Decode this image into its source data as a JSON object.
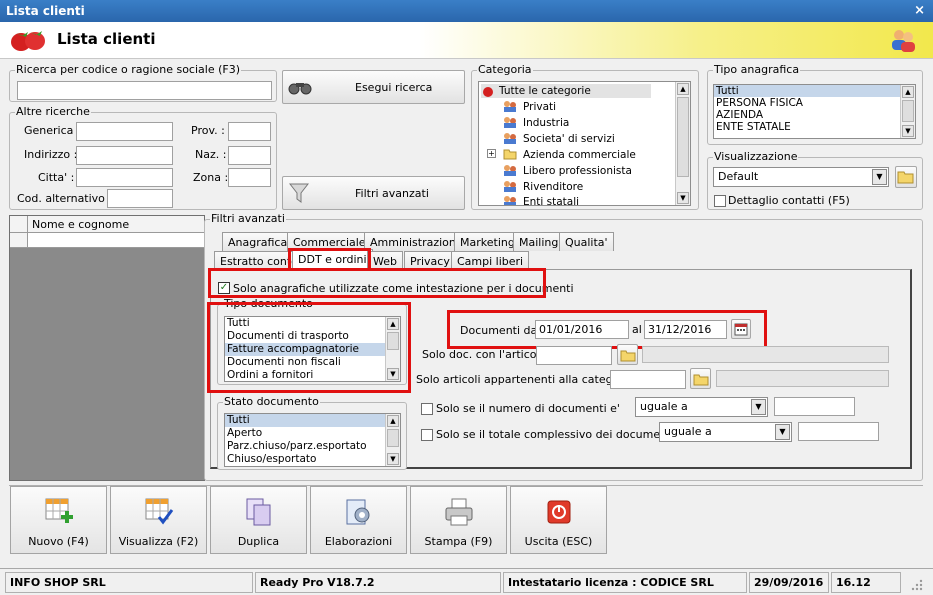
{
  "window": {
    "title": "Lista clienti",
    "close": "×"
  },
  "header": {
    "title": "Lista clienti"
  },
  "search": {
    "label": "Ricerca per codice o ragione sociale (F3)",
    "value": "",
    "button": "Esegui ricerca"
  },
  "altre": {
    "label": "Altre ricerche",
    "generica": "Generica :",
    "prov": "Prov. :",
    "indirizzo": "Indirizzo :",
    "naz": "Naz. :",
    "citta": "Citta' :",
    "zona": "Zona :",
    "cod": "Cod. alternativo :"
  },
  "filtri_button": "Filtri avanzati",
  "categoria": {
    "label": "Categoria",
    "items": [
      "Tutte le categorie",
      "Privati",
      "Industria",
      "Societa' di servizi",
      "Azienda commerciale",
      "Libero professionista",
      "Rivenditore",
      "Enti statali"
    ]
  },
  "tipo": {
    "label": "Tipo anagrafica",
    "items": [
      "Tutti",
      "PERSONA FISICA",
      "AZIENDA",
      "ENTE STATALE"
    ]
  },
  "visualizzazione": {
    "label": "Visualizzazione",
    "value": "Default",
    "dettaglio": "Dettaglio contatti (F5)"
  },
  "grid": {
    "header": "Nome e cognome"
  },
  "filtri": {
    "label": "Filtri avanzati",
    "tabs_row1": [
      "Anagrafica",
      "Commerciale",
      "Amministrazione",
      "Marketing",
      "Mailing",
      "Qualita'"
    ],
    "tabs_row2": [
      "Estratto conto",
      "DDT e ordini",
      "Web",
      "Privacy",
      "Campi liberi"
    ],
    "solo_check": "Solo anagrafiche utilizzate come intestazione per i documenti",
    "tipo_doc": {
      "label": "Tipo documento",
      "items": [
        "Tutti",
        "Documenti di trasporto",
        "Fatture accompagnatorie",
        "Documenti non fiscali",
        "Ordini a fornitori"
      ]
    },
    "stato_doc": {
      "label": "Stato documento",
      "items": [
        "Tutti",
        "Aperto",
        "Parz.chiuso/parz.esportato",
        "Chiuso/esportato"
      ]
    },
    "documenti_dal": "Documenti dal",
    "data_da": "01/01/2016",
    "al": "al",
    "data_a": "31/12/2016",
    "solo_articolo": "Solo doc. con l'articolo",
    "solo_categoria": "Solo articoli appartenenti alla categoria",
    "solo_numero": "Solo se il numero di documenti e'",
    "solo_totale": "Solo se il totale complessivo dei documenti e'",
    "uguale1": "uguale a",
    "uguale2": "uguale a"
  },
  "buttons": [
    "Nuovo (F4)",
    "Visualizza (F2)",
    "Duplica",
    "Elaborazioni",
    "Stampa (F9)",
    "Uscita (ESC)"
  ],
  "status": {
    "company": "INFO SHOP SRL",
    "version": "Ready Pro V18.7.2",
    "licenza": "Intestatario licenza : CODICE SRL",
    "date": "29/09/2016",
    "time": "16.12"
  }
}
